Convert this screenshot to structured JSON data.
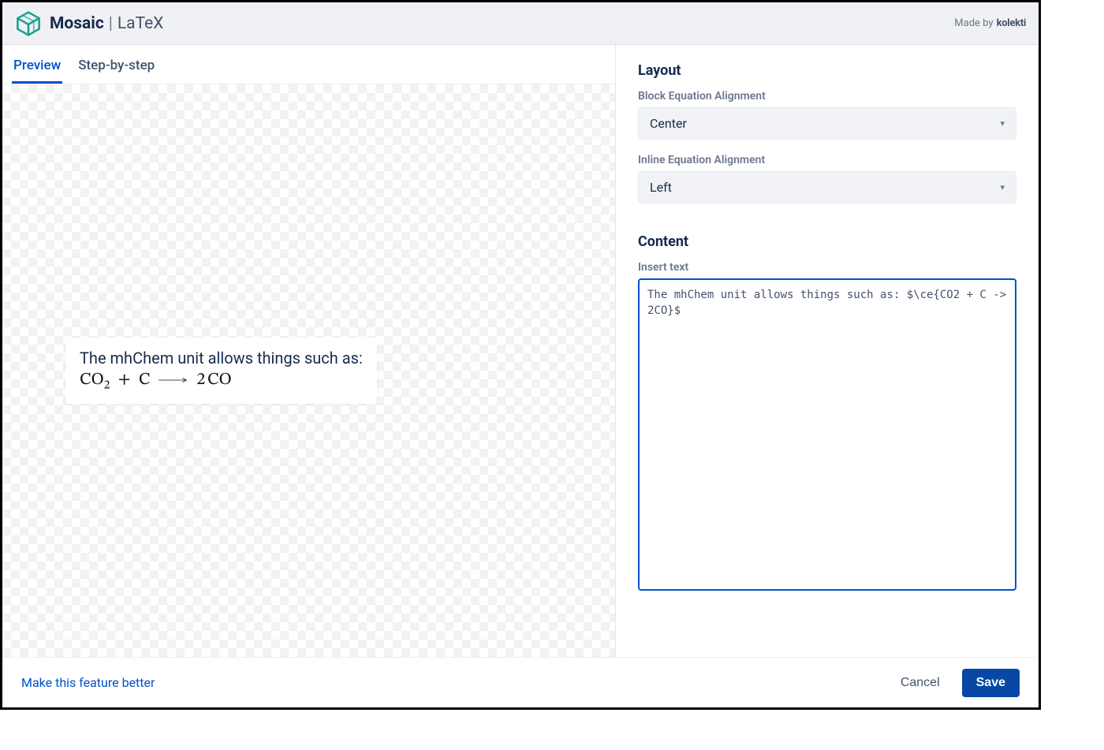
{
  "header": {
    "app_name": "Mosaic",
    "separator": "|",
    "module": "LaTeX",
    "made_by_prefix": "Made by",
    "vendor": "kolekti"
  },
  "tabs": {
    "preview": "Preview",
    "step_by_step": "Step-by-step"
  },
  "preview": {
    "text_line": "The mhChem unit allows things such as:",
    "formula_co": "CO",
    "formula_sub2": "2",
    "formula_plus": "+",
    "formula_c": "C",
    "formula_two": "2",
    "formula_co2nd": "CO"
  },
  "sidebar": {
    "layout_title": "Layout",
    "block_align_label": "Block Equation Alignment",
    "block_align_value": "Center",
    "inline_align_label": "Inline Equation Alignment",
    "inline_align_value": "Left",
    "content_title": "Content",
    "insert_text_label": "Insert text",
    "textarea_value": "The mhChem unit allows things such as: $\\ce{CO2 + C -> 2CO}$"
  },
  "footer": {
    "feedback": "Make this feature better",
    "cancel": "Cancel",
    "save": "Save"
  }
}
